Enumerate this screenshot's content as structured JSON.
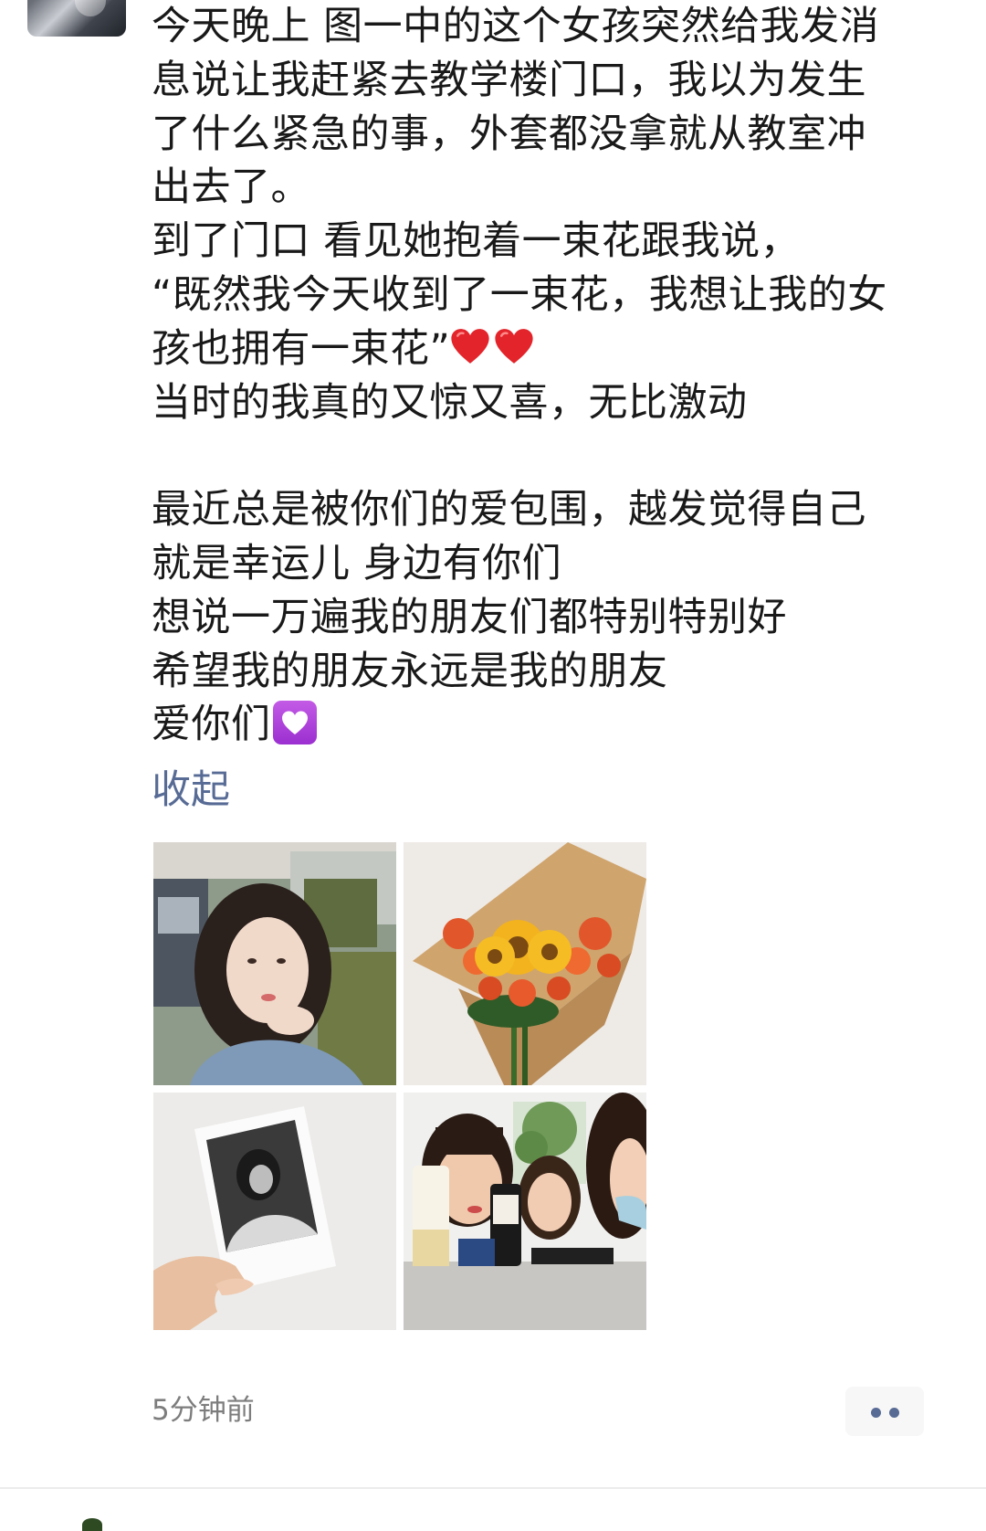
{
  "post": {
    "text_lines": [
      "今天晚上 图一中的这个女孩突然给我发消",
      "息说让我赶紧去教学楼门口，我以为发生",
      "了什么紧急的事，外套都没拿就从教室冲",
      "出去了。",
      "到了门口 看见她抱着一束花跟我说，",
      "“既然我今天收到了一束花，我想让我的女",
      "孩也拥有一束花”",
      "当时的我真的又惊又喜，无比激动",
      "最近总是被你们的爱包围，越发觉得自己",
      "就是幸运儿 身边有你们",
      "想说一万遍我的朋友们都特别特别好",
      "希望我的朋友永远是我的朋友",
      "爱你们"
    ],
    "emoji": {
      "line7": "red-heart-emoji x2",
      "line13": "purple-heart-emoji"
    },
    "collapse_label": "收起",
    "timestamp": "5分钟前"
  },
  "photos": [
    {
      "name": "photo-girl-in-car"
    },
    {
      "name": "photo-flower-bouquet"
    },
    {
      "name": "photo-polaroid-in-hand"
    },
    {
      "name": "photo-three-friends-with-drinks"
    }
  ],
  "colors": {
    "link": "#576b95",
    "text": "#191919",
    "timestamp": "#7d7d7d",
    "more_button_bg": "#f7f7f7",
    "heart_red": "#e3242b",
    "heart_purple": "#9b2fd0"
  }
}
